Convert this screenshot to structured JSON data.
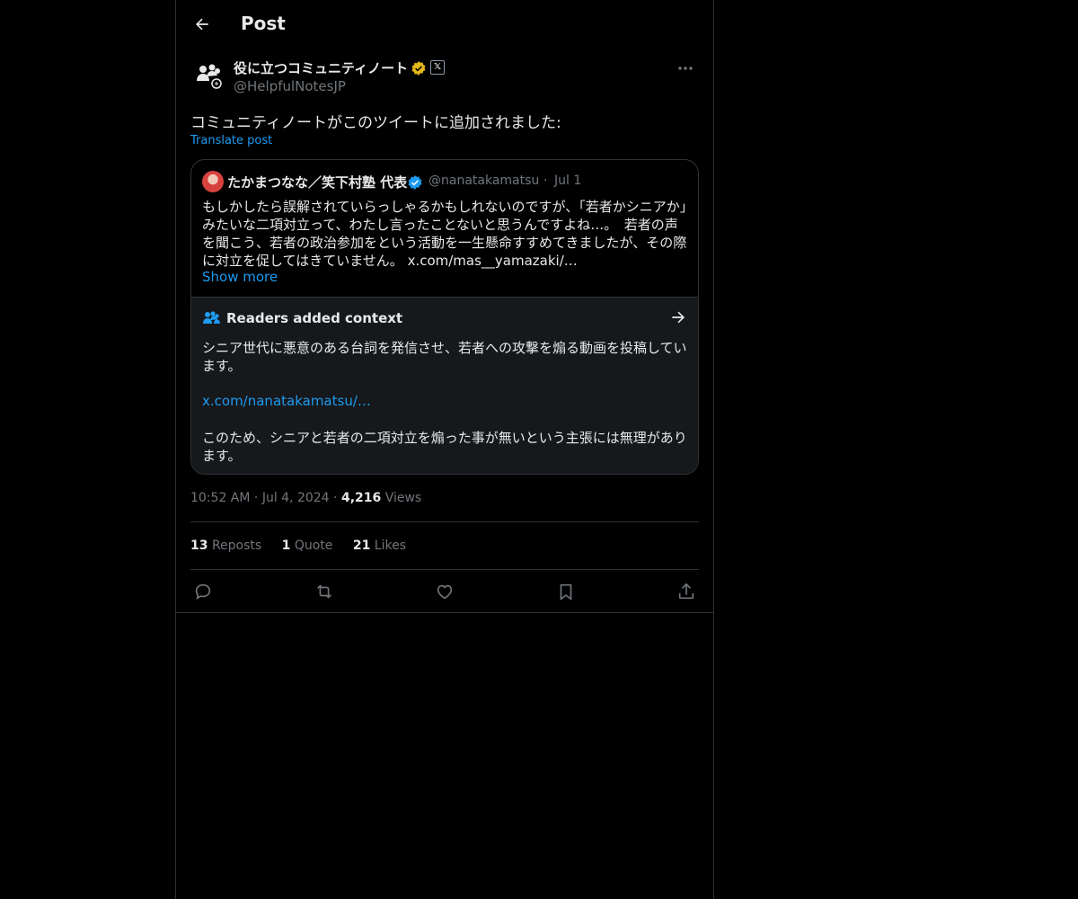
{
  "header": {
    "title": "Post"
  },
  "author": {
    "display_name": "役に立つコミュニティノート",
    "handle": "@HelpfulNotesJP",
    "x_badge": "𝕏"
  },
  "tweet": {
    "text": "コミュニティノートがこのツイートに追加されました:",
    "translate_label": "Translate post"
  },
  "quote": {
    "name": "たかまつなな／笑下村塾 代表",
    "handle": "@nanatakamatsu",
    "date": "Jul 1",
    "dot": "·",
    "body": "もしかしたら誤解されていらっしゃるかもしれないのですが、「若者かシニアか」みたいな二項対立って、わたし言ったことないと思うんですよね…。　若者の声を聞こう、若者の政治参加をという活動を一生懸命すすめてきましたが、その際に対立を促してはきていません。 x.com/mas__yamazaki/…",
    "show_more": "Show more"
  },
  "context": {
    "title": "Readers added context",
    "text1": "シニア世代に悪意のある台詞を発信させ、若者への攻撃を煽る動画を投稿しています。",
    "link": "x.com/nanatakamatsu/…",
    "text2": "このため、シニアと若者の二項対立を煽った事が無いという主張には無理があります。"
  },
  "meta": {
    "time": "10:52 AM",
    "date": "Jul 4, 2024",
    "views_count": "4,216",
    "views_label": "Views",
    "dot": "·"
  },
  "stats": {
    "reposts_count": "13",
    "reposts_label": "Reposts",
    "quote_count": "1",
    "quote_label": "Quote",
    "likes_count": "21",
    "likes_label": "Likes"
  },
  "colors": {
    "accent": "#1d9bf0",
    "gold": "#e2b719",
    "border": "#2f3336",
    "muted": "#71767b"
  },
  "icons": [
    "back-arrow-icon",
    "people-icon",
    "gold-verified-icon",
    "x-logo-icon",
    "more-icon",
    "verified-icon",
    "readers-icon",
    "arrow-right-icon",
    "reply-icon",
    "repost-icon",
    "like-icon",
    "bookmark-icon",
    "share-icon"
  ]
}
